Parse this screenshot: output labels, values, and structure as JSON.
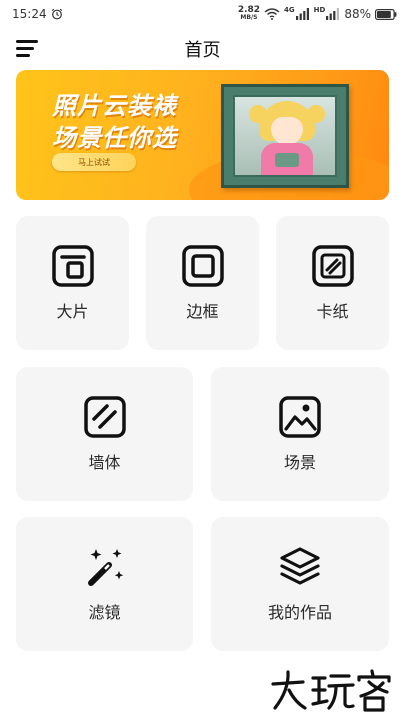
{
  "status_bar": {
    "time": "15:24",
    "alarm_icon": "alarm-clock-icon",
    "net_speed_value": "2.82",
    "net_speed_unit": "MB/S",
    "wifi_icon": "wifi-icon",
    "network_tag": "4G",
    "signal_icon": "cellular-signal-icon",
    "hd_tag": "HD",
    "battery_percent": "88%",
    "battery_level": 0.88,
    "battery_icon": "battery-icon"
  },
  "nav": {
    "menu_icon": "hamburger-menu-icon",
    "title": "首页"
  },
  "banner": {
    "title_line1": "照片云装裱",
    "title_line2": "场景任你选",
    "button_label": "马上试试",
    "picture": "framed-anime-photo"
  },
  "accent_colors": {
    "banner_start": "#ffc41a",
    "banner_end": "#ff8a10",
    "card_bg": "#f5f5f5"
  },
  "features": [
    {
      "label": "大片",
      "icon": "large-photo-frame-icon"
    },
    {
      "label": "边框",
      "icon": "border-frame-icon"
    },
    {
      "label": "卡纸",
      "icon": "cardboard-mat-icon"
    },
    {
      "label": "墙体",
      "icon": "wall-icon"
    },
    {
      "label": "场景",
      "icon": "landscape-scene-icon"
    },
    {
      "label": "滤镜",
      "icon": "magic-wand-icon"
    },
    {
      "label": "我的作品",
      "icon": "layers-stack-icon"
    }
  ],
  "watermark": {
    "image": "calligraphy-logo"
  }
}
